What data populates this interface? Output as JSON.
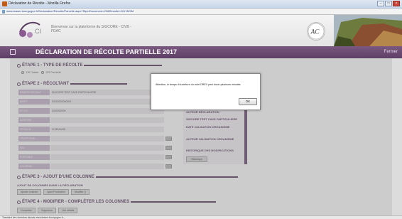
{
  "window": {
    "title": "Déclaration de Récolte - Mozilla Firefox",
    "url": "www.teaser.bourgogne.fr/Declaration/Recolte/Parcelle.aspx?SiperDocument=20&Recolte=2017&ISM"
  },
  "banner": {
    "welcome_line1": "Bienvenue sur la plateforme du SIGCORE - CIVB -",
    "welcome_line2": "FDAC",
    "logo_left": "logo",
    "logo_right": "logo"
  },
  "header": {
    "title": "DÉCLARATION DE RÉCOLTE PARTIELLE 2017",
    "close_label": "Fermer"
  },
  "steps": {
    "s1": "ÉTAPE 1 - TYPE DE RÉCOLTE",
    "s1_choices": [
      "DR Totale",
      "DR Partielle"
    ],
    "s2": "ÉTAPE 2 - RÉCOLTANT",
    "s3": "ÉTAPE 3 - AJOUT D'UNE COLONNE",
    "s3_note": "AJOUT DE COLONNES DANS LA DÉCLARATION",
    "s3_buttons": [
      "Ajouter colonne",
      "Ajout Production",
      "Modifier ()"
    ],
    "s4": "ÉTAPE 4 - MODIFIER - COMPLÉTER LES COLONNES",
    "s4_buttons": [
      "Compléter",
      "Supprimer",
      "Voir détails"
    ]
  },
  "recoltant": {
    "rows": [
      {
        "label": "RAISON SOCIALE",
        "value": "SIGCORE TEST CAVE PARTICULIERE"
      },
      {
        "label": "SIRET",
        "value": "00000000000000"
      },
      {
        "label": "N° CVI",
        "value": "0000000000"
      },
      {
        "label": "ADRESSE",
        "value": ""
      },
      {
        "label": "CP/VILLE",
        "value": "21 BEAUNE"
      },
      {
        "label": "TÉLÉPHONE",
        "value": ""
      },
      {
        "label": "FAX",
        "value": ""
      },
      {
        "label": "PORTABLE",
        "value": ""
      },
      {
        "label": "COURRIEL",
        "value": ""
      }
    ]
  },
  "sidepanel": {
    "items": [
      "AUTEUR DÉCLARATION",
      "SIGCORE TEST CAVE PARTICULIERE",
      "DATE VALIDATION ORGANISME",
      "AUTEUR VALIDATION ORGANISME",
      "HISTORIQUE DES MODIFICATIONS"
    ],
    "button": "Historique"
  },
  "modal": {
    "message": "Attention, le temps d'ouverture du volet DREV peut durer plusieurs minutes",
    "ok_label": "OK"
  },
  "statusbar": {
    "text": "Transfert des données depuis www.teaser.bourgogne.fr..."
  }
}
